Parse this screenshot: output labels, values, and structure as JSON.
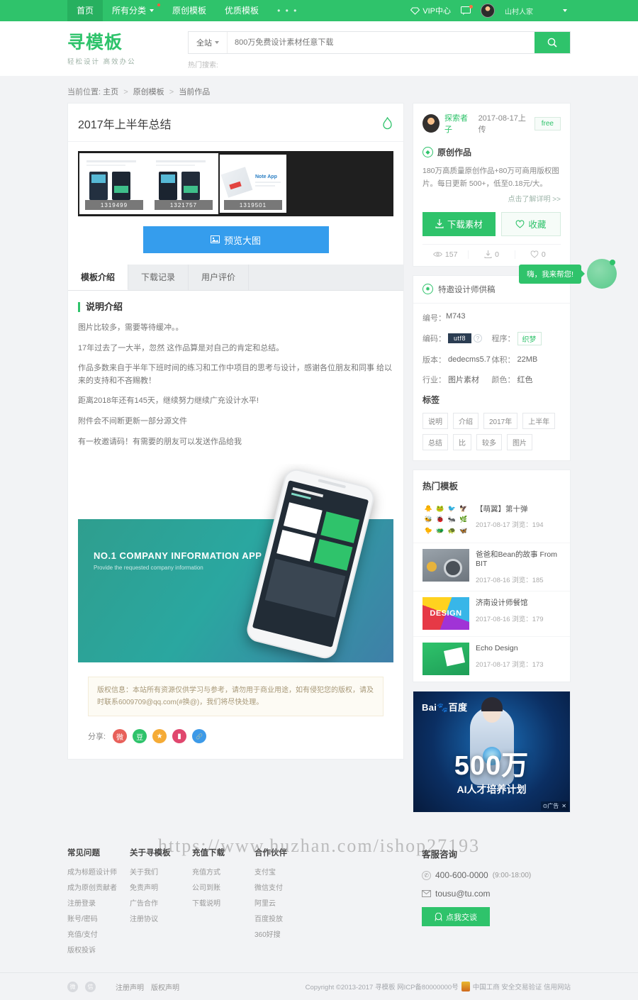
{
  "topnav": {
    "items": [
      {
        "label": "首页",
        "active": true,
        "dropdown": false,
        "dot": false
      },
      {
        "label": "所有分类",
        "active": false,
        "dropdown": true,
        "dot": true
      },
      {
        "label": "原创模板",
        "active": false,
        "dropdown": false,
        "dot": false
      },
      {
        "label": "优质模板",
        "active": false,
        "dropdown": false,
        "dot": false
      }
    ],
    "more": "• • •",
    "vip": "VIP中心",
    "username": "山村人家"
  },
  "header": {
    "logo": "寻模板",
    "slogan": "轻松设计  高效办公",
    "search_scope": "全站",
    "search_placeholder": "800万免费设计素材任意下载",
    "hot_label": "热门搜索:"
  },
  "breadcrumb": {
    "label": "当前位置:",
    "items": [
      "主页",
      "原创模板",
      "当前作品"
    ],
    "sep": ">"
  },
  "work": {
    "title": "2017年上半年总结",
    "fire_icon": "fire-icon",
    "thumbs": [
      {
        "id": "1319499",
        "selected": true
      },
      {
        "id": "1321757",
        "selected": false
      },
      {
        "id": "1319501",
        "selected": false
      }
    ],
    "preview_button": "预览大图"
  },
  "tabs": [
    {
      "label": "模板介绍",
      "active": true
    },
    {
      "label": "下载记录",
      "active": false
    },
    {
      "label": "用户评价",
      "active": false
    }
  ],
  "description": {
    "section_title": "说明介绍",
    "paragraphs": [
      "图片比较多，需要等待缓冲。。",
      "17年过去了一大半，忽然 这作品算是对自己的肯定和总结。",
      "作品多数来自于半年下班时间的练习和工作中项目的思考与设计，感谢各位朋友和同事 给以来的支持和不吝赐教！",
      "距离2018年还有145天，继续努力继续广充设计水平!",
      "附件会不间断更新一部分源文件",
      "有一枚邀请码！有需要的朋友可以发送作品给我"
    ],
    "bigshot": {
      "heading": "NO.1 COMPANY INFORMATION APP",
      "sub": "Provide the requested company information"
    },
    "notice": "版权信息：本站所有资源仅供学习与参考，请勿用于商业用途，如有侵犯您的版权，请及时联系6009709@qq.com(#换@)，我们将尽快处理。",
    "share_label": "分享:",
    "share_icons": [
      {
        "name": "weibo-share-icon",
        "glyph": "微",
        "color": "#e8605a"
      },
      {
        "name": "douban-share-icon",
        "glyph": "豆",
        "color": "#2fc36b"
      },
      {
        "name": "favorite-share-icon",
        "glyph": "★",
        "color": "#f5ab36"
      },
      {
        "name": "renren-share-icon",
        "glyph": "▮",
        "color": "#e0476e"
      },
      {
        "name": "link-share-icon",
        "glyph": "🔗",
        "color": "#3d9ae8"
      }
    ]
  },
  "author": {
    "name": "探索者子",
    "upload_meta": "2017-08-17上传",
    "badge": "free",
    "original_label": "原创作品",
    "original_desc": "180万高质量原创作品+80万可商用版权图片。每日更新 500+，低至0.18元/大。",
    "more_link": "点击了解详明 >>",
    "download_button": "下载素材",
    "favorite_button": "收藏",
    "stats": [
      {
        "name": "views",
        "icon": "eye-icon",
        "value": "157"
      },
      {
        "name": "downloads",
        "icon": "download-icon",
        "value": "0"
      },
      {
        "name": "likes",
        "icon": "heart-icon",
        "value": "0"
      }
    ]
  },
  "spec": {
    "head": "特邀设计师供稿",
    "id_key": "编号：",
    "id_value": "M743",
    "rows": [
      [
        {
          "key": "编码：",
          "value": "utf8",
          "style": "dark",
          "help": true
        },
        {
          "key": "程序：",
          "value": "织梦",
          "style": "green"
        }
      ],
      [
        {
          "key": "版本：",
          "value": "dedecms5.7",
          "style": "plain"
        },
        {
          "key": "体积：",
          "value": "22MB",
          "style": "plain"
        }
      ],
      [
        {
          "key": "行业：",
          "value": "图片素材",
          "style": "plain"
        },
        {
          "key": "颜色：",
          "value": "红色",
          "style": "plain"
        }
      ]
    ],
    "tags_title": "标签",
    "tags": [
      "说明",
      "介绍",
      "2017年",
      "上半年",
      "总结",
      "比",
      "较多",
      "图片"
    ]
  },
  "hot": {
    "title": "热门模板",
    "items": [
      {
        "title": "【萌翼】第十弹",
        "meta": "2017-08-17   浏览：194",
        "thumb": "emoji-grid"
      },
      {
        "title": "爸爸和Bean的故事 From BIT",
        "meta": "2017-08-16   浏览：185",
        "thumb": "camera"
      },
      {
        "title": "济南设计师餐馆",
        "meta": "2017-08-16   浏览：179",
        "thumb": "design"
      },
      {
        "title": "Echo Design",
        "meta": "2017-08-17   浏览：173",
        "thumb": "echo"
      }
    ]
  },
  "ad": {
    "brand": "Bai",
    "brand_cn": "百度",
    "headline": "500万",
    "subline": "AI人才培养计划",
    "mark": "⊙广告",
    "close": "✕"
  },
  "chat": {
    "bubble": "嗨，我来帮您!"
  },
  "watermark": "https://www.huzhan.com/ishop27193",
  "footer": {
    "columns": [
      {
        "head": "常见问题",
        "links": [
          "成为标题设计师",
          "成为原创贡献者",
          "注册登录",
          "账号/密码",
          "充值/支付",
          "版权投诉"
        ]
      },
      {
        "head": "关于寻模板",
        "links": [
          "关于我们",
          "免责声明",
          "广告合作",
          "注册协议"
        ]
      },
      {
        "head": "充值下载",
        "links": [
          "充值方式",
          "公司到账",
          "下载说明"
        ]
      },
      {
        "head": "合作伙伴",
        "links": [
          "支付宝",
          "微信支付",
          "阿里云",
          "百度投放",
          "360好搜"
        ]
      }
    ],
    "service": {
      "head": "客服咨询",
      "phone": "400-600-0000",
      "hours": "(9:00-18:00)",
      "email": "tousu@tu.com",
      "chat_button": "点我交谈"
    },
    "bottom": {
      "links": [
        "注册声明",
        "版权声明"
      ],
      "copyright": "Copyright ©2013-2017 寻模板 网ICP备80000000号",
      "cert": "中国工商 安全交易验证 信用网站"
    }
  }
}
